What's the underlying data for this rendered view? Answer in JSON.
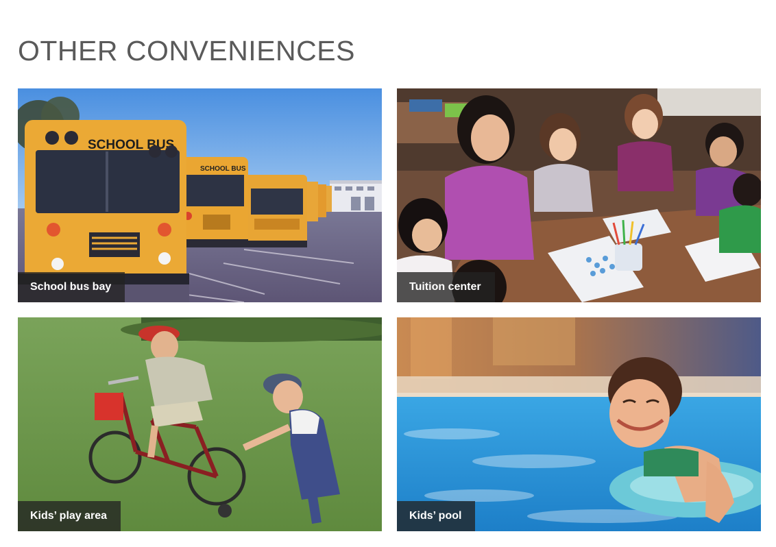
{
  "page": {
    "title": "OTHER CONVENIENCES"
  },
  "tiles": [
    {
      "caption": "School bus bay",
      "image": "school-buses-photo"
    },
    {
      "caption": "Tuition center",
      "image": "children-drawing-with-teacher-photo"
    },
    {
      "caption": "Kids’ play area",
      "image": "kids-with-bicycle-on-lawn-photo"
    },
    {
      "caption": "Kids’ pool",
      "image": "girl-swimming-in-pool-photo"
    }
  ],
  "photo_text": {
    "bus_sign": "SCHOOL BUS"
  },
  "colors": {
    "title": "#5a5a5a",
    "caption_bg": "#232323",
    "caption_text": "#ffffff"
  }
}
